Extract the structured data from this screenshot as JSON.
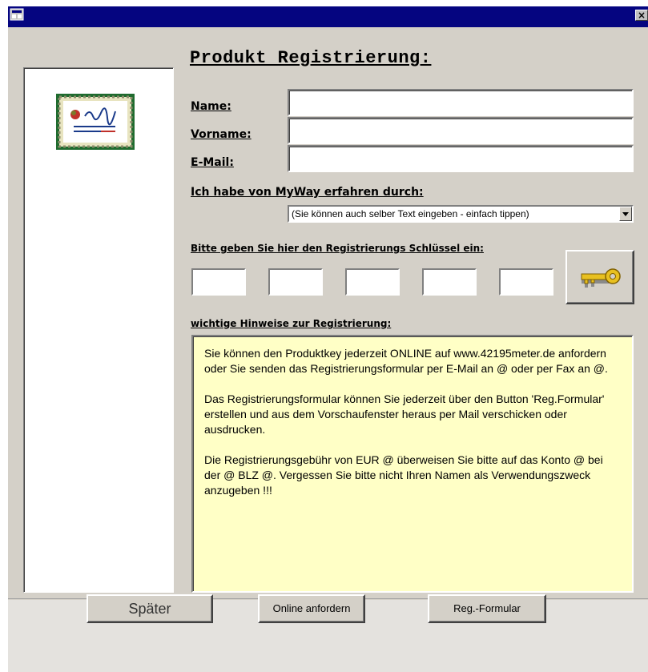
{
  "window": {
    "close_glyph": "×",
    "system_icon": "access-form-icon"
  },
  "form": {
    "title": "Produkt Registrierung:",
    "name_label": "Name:",
    "vorname_label": "Vorname:",
    "email_label": "E-Mail:",
    "name_value": "",
    "vorname_value": "",
    "email_value": "",
    "source_label": "Ich habe von MyWay erfahren durch:",
    "source_value": "(Sie können auch selber Text eingeben - einfach tippen)",
    "key_label": "Bitte geben Sie hier den Registrierungs Schlüssel ein:",
    "key_parts": [
      "",
      "",
      "",
      "",
      ""
    ],
    "notes_label": "wichtige Hinweise zur Registrierung:",
    "notes": [
      "Sie können den Produktkey jederzeit ONLINE auf www.42195meter.de anfordern oder Sie senden das Registrierungsformular per E-Mail an @ oder per Fax an @.",
      "Das Registrierungsformular können Sie jederzeit über den Button 'Reg.Formular' erstellen und aus dem Vorschaufenster heraus per Mail verschicken oder ausdrucken.",
      "Die Registrierungsgebühr von EUR @ überweisen Sie bitte auf das Konto @ bei der @ BLZ @. Vergessen Sie bitte nicht Ihren Namen als Verwendungszweck anzugeben !!!"
    ]
  },
  "buttons": {
    "later": "Später",
    "online": "Online anfordern",
    "regform": "Reg.-Formular"
  },
  "colors": {
    "titlebar": "#050580",
    "window_bg": "#d4d0c8",
    "notes_bg": "#ffffc6"
  }
}
